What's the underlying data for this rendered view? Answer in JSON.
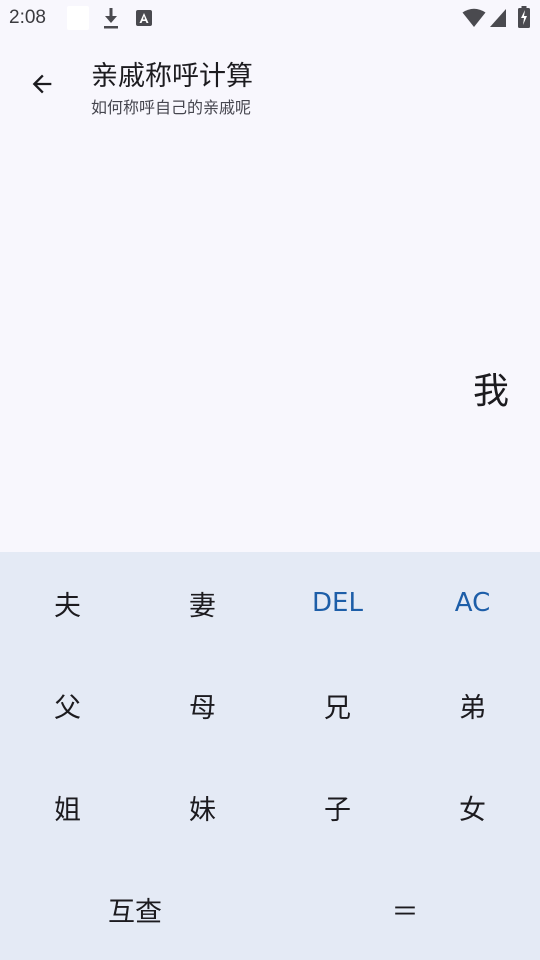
{
  "status_bar": {
    "time": "2:08",
    "icons": [
      "white-square-icon",
      "download-icon",
      "font-a-icon",
      "wifi-icon",
      "cell-signal-icon",
      "battery-charging-icon"
    ]
  },
  "app_bar": {
    "back_icon": "arrow-back-icon",
    "title": "亲戚称呼计算",
    "subtitle": "如何称呼自己的亲戚呢"
  },
  "display": {
    "value": "我"
  },
  "keypad": {
    "rows": [
      [
        "夫",
        "妻",
        "DEL",
        "AC"
      ],
      [
        "父",
        "母",
        "兄",
        "弟"
      ],
      [
        "姐",
        "妹",
        "子",
        "女"
      ],
      [
        "互查",
        "＝"
      ]
    ]
  },
  "colors": {
    "background": "#f8f7fd",
    "keypad_background": "#e4eaf5",
    "accent": "#1d5ea8",
    "text": "#1c1b1f"
  }
}
